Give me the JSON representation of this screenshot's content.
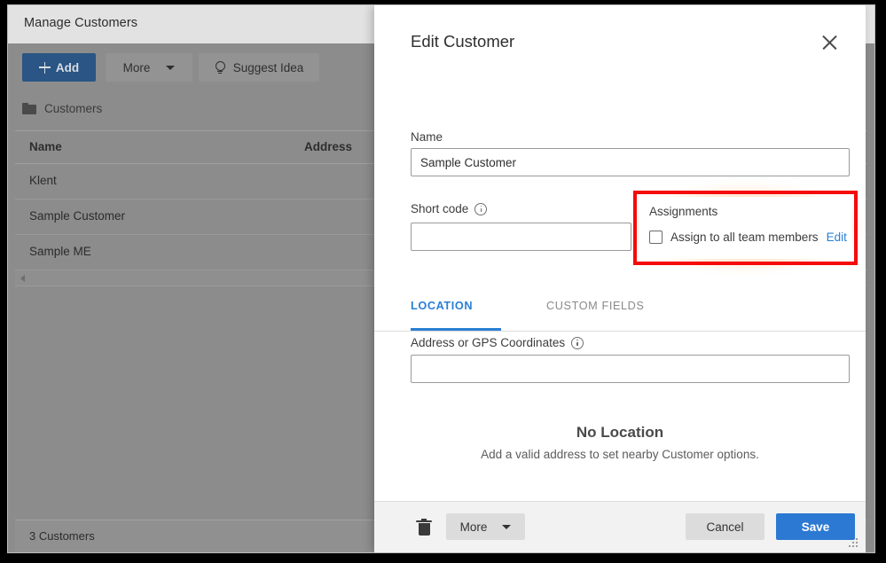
{
  "window": {
    "title": "Manage Customers",
    "close_icon": "close-icon"
  },
  "background_app": {
    "toolbar": {
      "add_label": "Add",
      "more_label": "More",
      "suggest_label": "Suggest Idea"
    },
    "breadcrumb": {
      "label": "Customers",
      "icon": "folder-icon"
    },
    "table": {
      "columns": [
        "Name",
        "Address"
      ],
      "rows": [
        {
          "name": "Klent",
          "address": ""
        },
        {
          "name": "Sample Customer",
          "address": ""
        },
        {
          "name": "Sample ME",
          "address": ""
        }
      ]
    },
    "status": "3 Customers"
  },
  "modal": {
    "title": "Edit Customer",
    "close_icon": "close-icon",
    "name": {
      "label": "Name",
      "value": "Sample Customer",
      "placeholder": ""
    },
    "short_code": {
      "label": "Short code",
      "value": "",
      "placeholder": "",
      "info_icon": "info-icon"
    },
    "assignments": {
      "label": "Assignments",
      "checkbox_label": "Assign to all team members",
      "checked": false,
      "edit_link": "Edit",
      "highlight_color": "#f50b0b",
      "highlight_glow_color": "#ff9628"
    },
    "tabs": [
      {
        "label": "LOCATION",
        "active": true
      },
      {
        "label": "CUSTOM FIELDS",
        "active": false
      }
    ],
    "location": {
      "address_label": "Address or GPS Coordinates",
      "address_value": "",
      "address_placeholder": "",
      "info_icon": "info-icon",
      "empty_title": "No Location",
      "empty_subtitle": "Add a valid address to set nearby Customer options."
    },
    "footer": {
      "delete_icon": "trash-icon",
      "more_label": "More",
      "cancel_label": "Cancel",
      "save_label": "Save",
      "accent_color": "#2c79d3"
    }
  }
}
